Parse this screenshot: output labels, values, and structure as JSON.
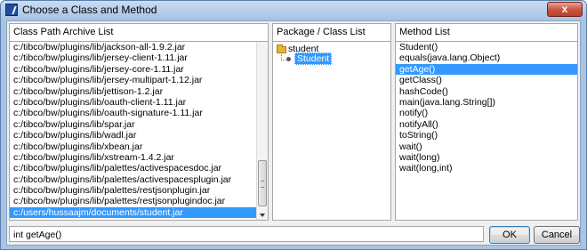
{
  "window": {
    "title": "Choose a Class and Method",
    "close_label": "x"
  },
  "class_path": {
    "header": "Class Path Archive List",
    "items": [
      "c:/tibco/bw/plugins/lib/jackson-all-1.9.2.jar",
      "c:/tibco/bw/plugins/lib/jersey-client-1.11.jar",
      "c:/tibco/bw/plugins/lib/jersey-core-1.11.jar",
      "c:/tibco/bw/plugins/lib/jersey-multipart-1.12.jar",
      "c:/tibco/bw/plugins/lib/jettison-1.2.jar",
      "c:/tibco/bw/plugins/lib/oauth-client-1.11.jar",
      "c:/tibco/bw/plugins/lib/oauth-signature-1.11.jar",
      "c:/tibco/bw/plugins/lib/spar.jar",
      "c:/tibco/bw/plugins/lib/wadl.jar",
      "c:/tibco/bw/plugins/lib/xbean.jar",
      "c:/tibco/bw/plugins/lib/xstream-1.4.2.jar",
      "c:/tibco/bw/plugins/lib/palettes/activespacesdoc.jar",
      "c:/tibco/bw/plugins/lib/palettes/activespacesplugin.jar",
      "c:/tibco/bw/plugins/lib/palettes/restjsonplugin.jar",
      "c:/tibco/bw/plugins/lib/palettes/restjsonplugindoc.jar",
      "c:/users/hussaajm/documents/student.jar"
    ],
    "selected_index": 15
  },
  "package_list": {
    "header": "Package / Class List",
    "package": "student",
    "class": "Student"
  },
  "method_list": {
    "header": "Method List",
    "items": [
      "Student()",
      "equals(java.lang.Object)",
      "getAge()",
      "getClass()",
      "hashCode()",
      "main(java.lang.String[])",
      "notify()",
      "notifyAll()",
      "toString()",
      "wait()",
      "wait(long)",
      "wait(long,int)"
    ],
    "selected_index": 2
  },
  "status": {
    "signature": "int getAge()"
  },
  "buttons": {
    "ok": "OK",
    "cancel": "Cancel"
  }
}
